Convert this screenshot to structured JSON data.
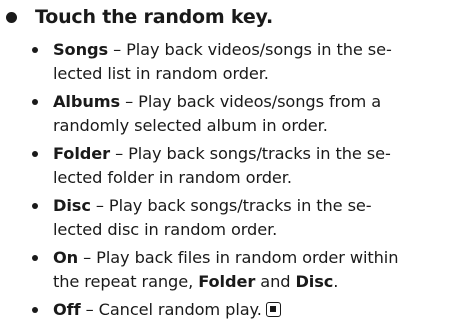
{
  "heading": "Touch the random key.",
  "items": [
    {
      "term": "Songs",
      "line1": " – Play back videos/songs in the se-",
      "line2": "lected list in random order."
    },
    {
      "term": "Albums",
      "line1": " – Play back videos/songs from a",
      "line2": "randomly selected album in order."
    },
    {
      "term": "Folder",
      "line1": " – Play back songs/tracks in the se-",
      "line2": "lected folder in random order."
    },
    {
      "term": "Disc",
      "line1": " – Play back songs/tracks in the se-",
      "line2": "lected disc in random order."
    },
    {
      "term": "On",
      "line1": " – Play back files in random order within",
      "line2a": "the repeat range, ",
      "bold_a": "Folder",
      "line2b": " and ",
      "bold_b": "Disc",
      "line2c": "."
    },
    {
      "term": "Off",
      "line1": " – Cancel random play.",
      "end_icon": "end-of-section-icon"
    }
  ]
}
